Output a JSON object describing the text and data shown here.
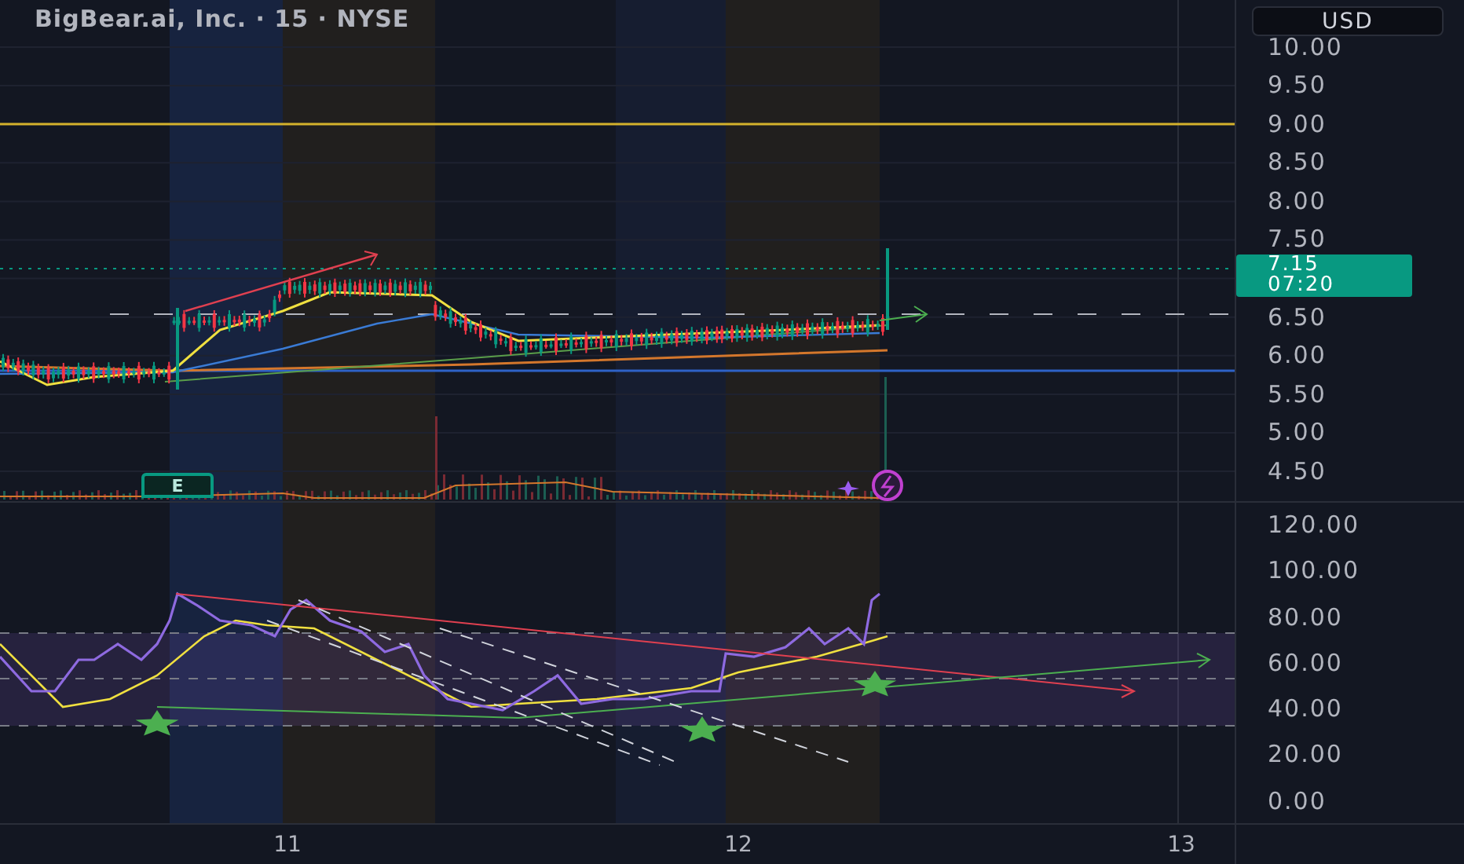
{
  "title": "BigBear.ai, Inc. · 15 · NYSE",
  "currency_button": "USD",
  "price_axis": [
    "10.00",
    "9.50",
    "9.00",
    "8.50",
    "8.00",
    "7.50",
    "6.50",
    "6.00",
    "5.50",
    "5.00",
    "4.50"
  ],
  "last_price": {
    "price": "7.15",
    "countdown": "07:20"
  },
  "earnings_marker": "E",
  "rsi_axis": [
    "120.00",
    "100.00",
    "80.00",
    "60.00",
    "40.00",
    "20.00",
    "0.00"
  ],
  "time_axis": [
    "11",
    "12",
    "13"
  ]
}
